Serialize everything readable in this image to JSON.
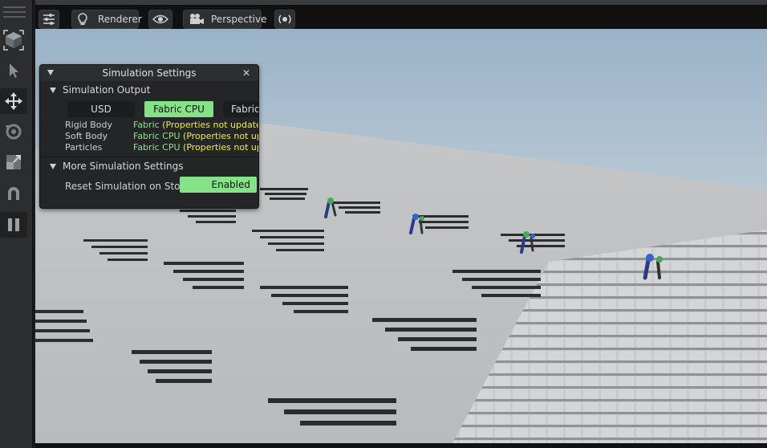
{
  "toolbar": {
    "tools": [
      {
        "name": "cube-icon"
      },
      {
        "name": "select-arrow-icon"
      },
      {
        "name": "move-icon"
      },
      {
        "name": "rotate-icon"
      },
      {
        "name": "scale-icon"
      },
      {
        "name": "snap-magnet-icon"
      },
      {
        "name": "pause-icon"
      }
    ]
  },
  "viewport_bar": {
    "renderer_label": "Renderer",
    "perspective_label": "Perspective"
  },
  "panel": {
    "title": "Simulation Settings",
    "close_glyph": "✕",
    "output_section": "Simulation Output",
    "tabs": [
      "USD",
      "Fabric CPU",
      "Fabric"
    ],
    "active_tab": "Fabric CPU",
    "rows": [
      {
        "label": "Rigid Body",
        "value": "Fabric",
        "note": "(Properties not updated)"
      },
      {
        "label": "Soft Body",
        "value": "Fabric CPU",
        "note": "(Properties not updated)"
      },
      {
        "label": "Particles",
        "value": "Fabric CPU",
        "note": "(Properties not updated)"
      }
    ],
    "more_section": "More Simulation Settings",
    "reset_label": "Reset Simulation on Stop",
    "reset_value": "Enabled"
  },
  "colors": {
    "accent_green": "#86e286",
    "note_yellow": "#f0f03c",
    "value_green": "#8fe28b"
  }
}
